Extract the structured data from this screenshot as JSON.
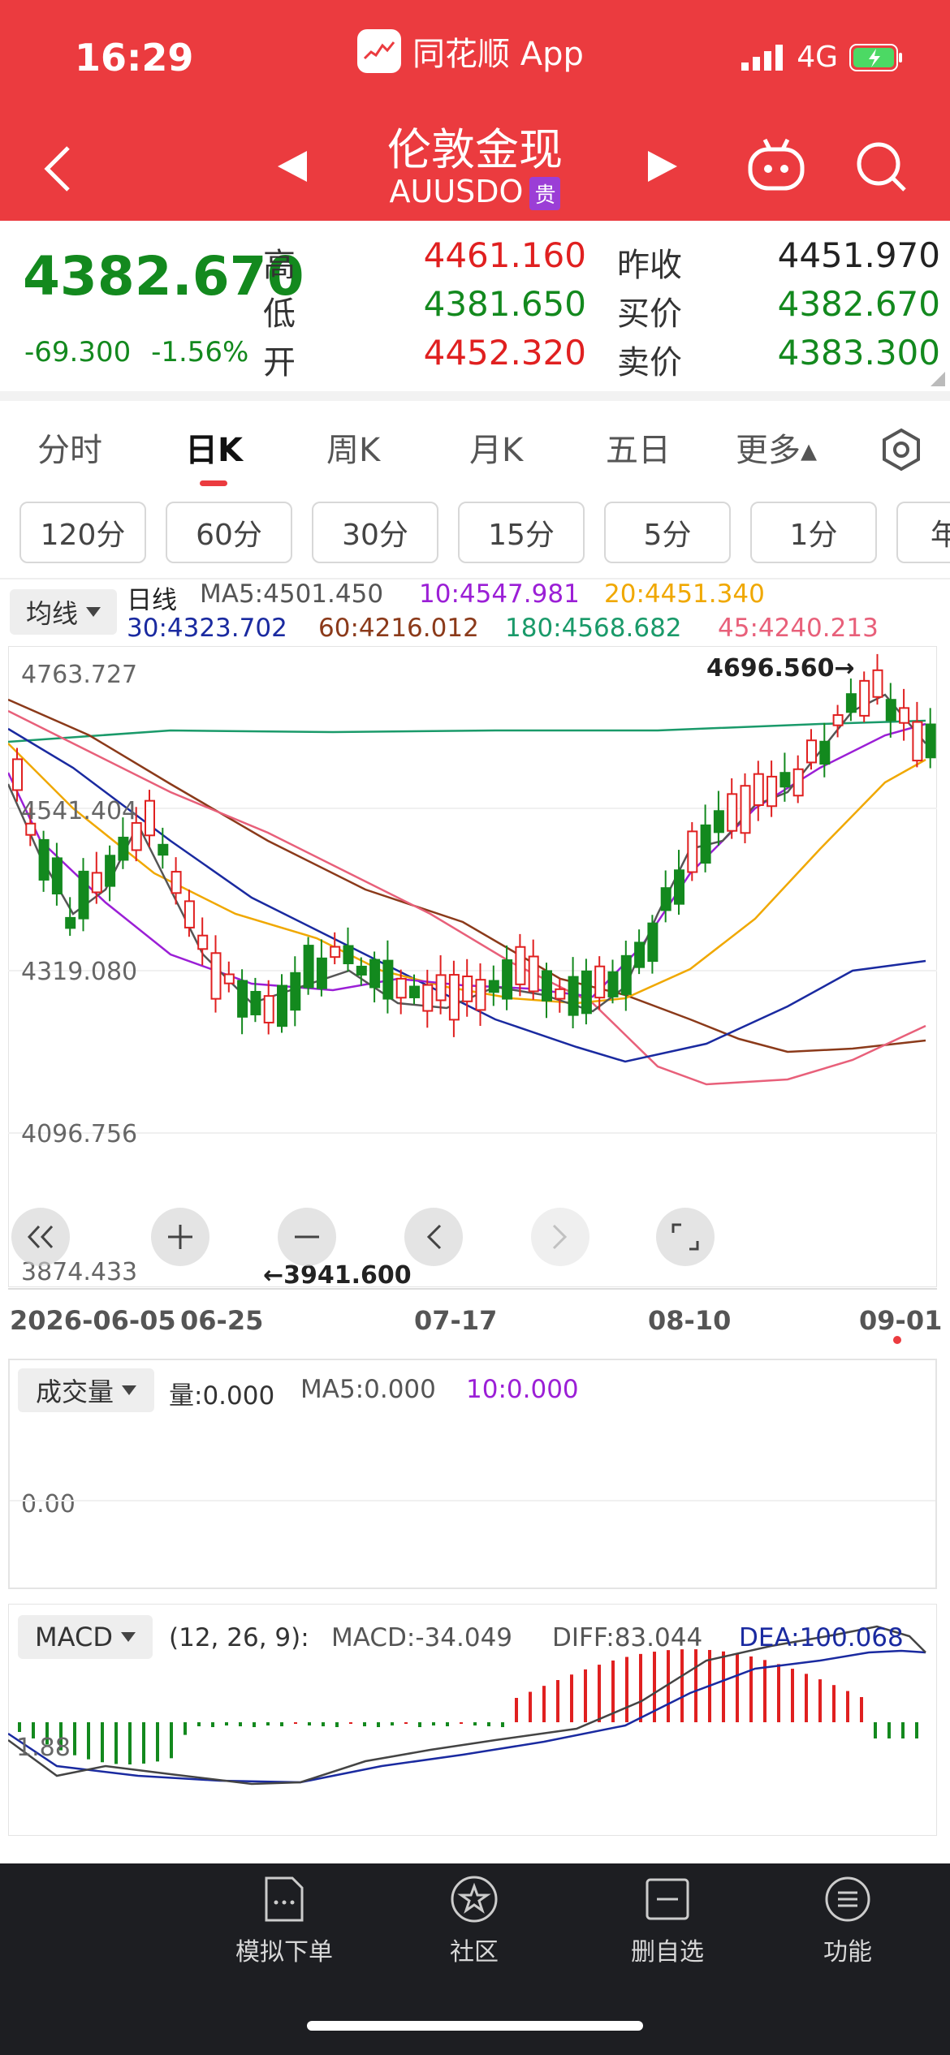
{
  "status_bar": {
    "time": "16:29",
    "app_name": "同花顺 App",
    "network": "4G"
  },
  "header": {
    "title": "伦敦金现",
    "code": "AUUSDO",
    "badge": "贵"
  },
  "quote": {
    "price": "4382.670",
    "change": "-69.300",
    "change_pct": "-1.56%",
    "high_label": "高",
    "high": "4461.160",
    "low_label": "低",
    "low": "4381.650",
    "open_label": "开",
    "open": "4452.320",
    "prev_close_label": "昨收",
    "prev_close": "4451.970",
    "bid_label": "买价",
    "bid": "4382.670",
    "ask_label": "卖价",
    "ask": "4383.300"
  },
  "tabs": [
    "分时",
    "日K",
    "周K",
    "月K",
    "五日",
    "更多▴"
  ],
  "intervals": [
    "120分",
    "60分",
    "30分",
    "15分",
    "5分",
    "1分",
    "年"
  ],
  "ma_legend": {
    "selector": "均线",
    "period": "日线",
    "ma5": "MA5:4501.450",
    "ma10": "10:4547.981",
    "ma20": "20:4451.340",
    "ma30": "30:4323.702",
    "ma60": "60:4216.012",
    "ma180": "180:4568.682",
    "ma45": "45:4240.213"
  },
  "price_axis": [
    "4763.727",
    "4541.404",
    "4319.080",
    "4096.756",
    "3874.433"
  ],
  "max_marker": "4696.560→",
  "min_marker": "←3941.600",
  "dates": [
    "2026-06-05",
    "06-25",
    "07-17",
    "08-10",
    "09-01"
  ],
  "volume": {
    "selector": "成交量",
    "vol": "量:0.000",
    "ma5": "MA5:0.000",
    "ma10": "10:0.000",
    "axis": "0.00"
  },
  "macd": {
    "selector": "MACD",
    "params": "(12, 26, 9):",
    "macd": "MACD:-34.049",
    "diff": "DIFF:83.044",
    "dea": "DEA:100.068",
    "axis": "1.88"
  },
  "bottom_nav": [
    "模拟下单",
    "社区",
    "删自选",
    "功能"
  ],
  "colors": {
    "brand": "#eb3b3f",
    "up": "#e02020",
    "down": "#13891e",
    "ma5": "#555555",
    "ma10": "#9b1fd6",
    "ma20": "#f0a800",
    "ma30": "#1a2aa0",
    "ma60": "#8b3a1a",
    "ma180": "#1a9a6a",
    "ma45": "#e8607a"
  },
  "chart_data": {
    "type": "candlestick",
    "y_range": [
      3874.433,
      4763.727
    ],
    "x_range": [
      "2026-06-05",
      "09-01"
    ],
    "max_marker": 4696.56,
    "min_marker": 3941.6
  }
}
